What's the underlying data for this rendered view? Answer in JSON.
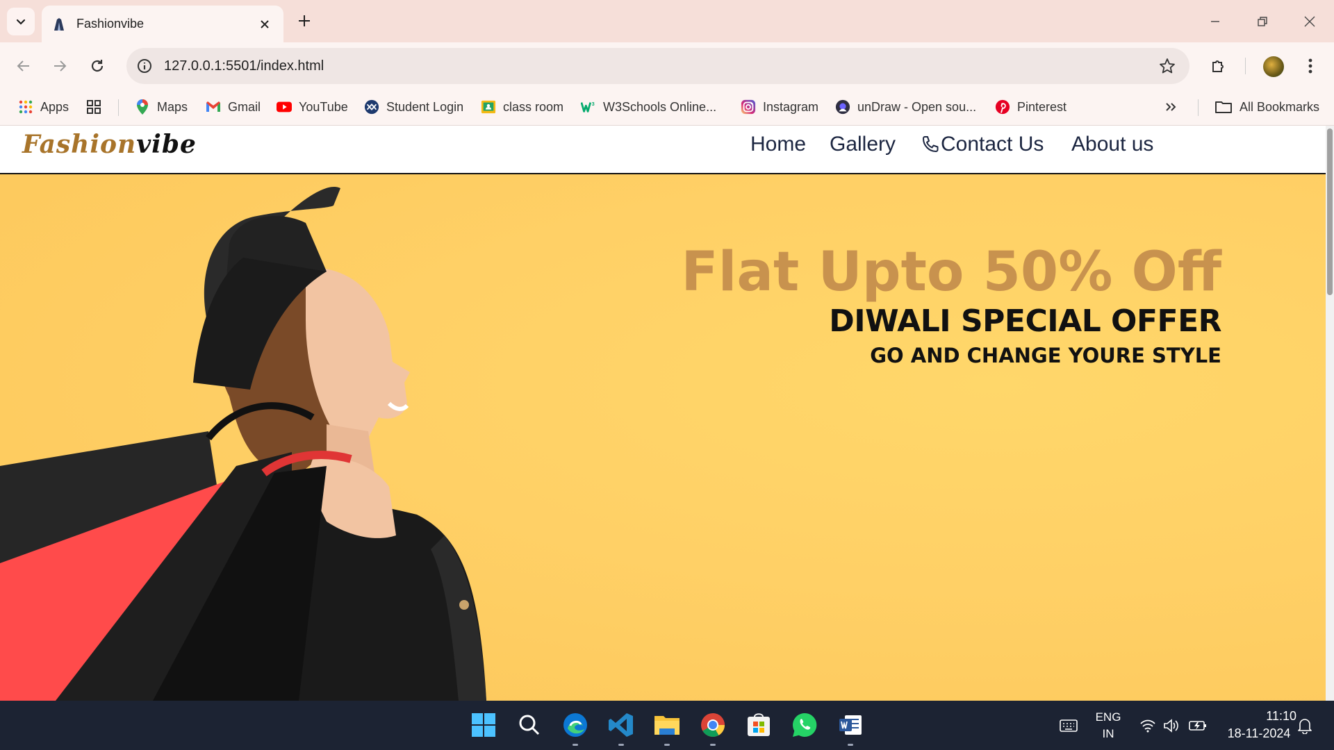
{
  "browser": {
    "tab": {
      "title": "Fashionvibe"
    },
    "url": "127.0.0.1:5501/index.html",
    "bookmarks": [
      {
        "label": "Apps",
        "icon": "apps-grid-icon"
      },
      {
        "label": "",
        "icon": "tab-groups-icon"
      },
      {
        "label": "Maps",
        "icon": "maps-icon"
      },
      {
        "label": "Gmail",
        "icon": "gmail-icon"
      },
      {
        "label": "YouTube",
        "icon": "youtube-icon"
      },
      {
        "label": "Student Login",
        "icon": "student-login-icon"
      },
      {
        "label": "class room",
        "icon": "classroom-icon"
      },
      {
        "label": "W3Schools Online...",
        "icon": "w3schools-icon"
      },
      {
        "label": "Instagram",
        "icon": "instagram-icon"
      },
      {
        "label": "unDraw - Open sou...",
        "icon": "undraw-icon"
      },
      {
        "label": "Pinterest",
        "icon": "pinterest-icon"
      }
    ],
    "all_bookmarks": "All Bookmarks"
  },
  "site": {
    "logo_part1": "Fashion",
    "logo_part2": "vibe",
    "nav": [
      "Home",
      "Gallery",
      "Contact Us",
      "About us"
    ],
    "hero": {
      "title": "Flat Upto 50% Off",
      "subtitle": "DIWALI SPECIAL OFFER",
      "tagline": "GO AND CHANGE YOURE STYLE"
    },
    "colors": {
      "hero_bg": "#ffd066",
      "title": "#c8924e",
      "logo_accent": "#a8742a"
    }
  },
  "taskbar": {
    "apps": [
      "windows-start-icon",
      "search-icon",
      "edge-icon",
      "vscode-icon",
      "file-explorer-icon",
      "chrome-icon",
      "microsoft-store-icon",
      "whatsapp-icon",
      "word-icon"
    ],
    "lang_top": "ENG",
    "lang_bottom": "IN",
    "time": "11:10",
    "date": "18-11-2024"
  }
}
